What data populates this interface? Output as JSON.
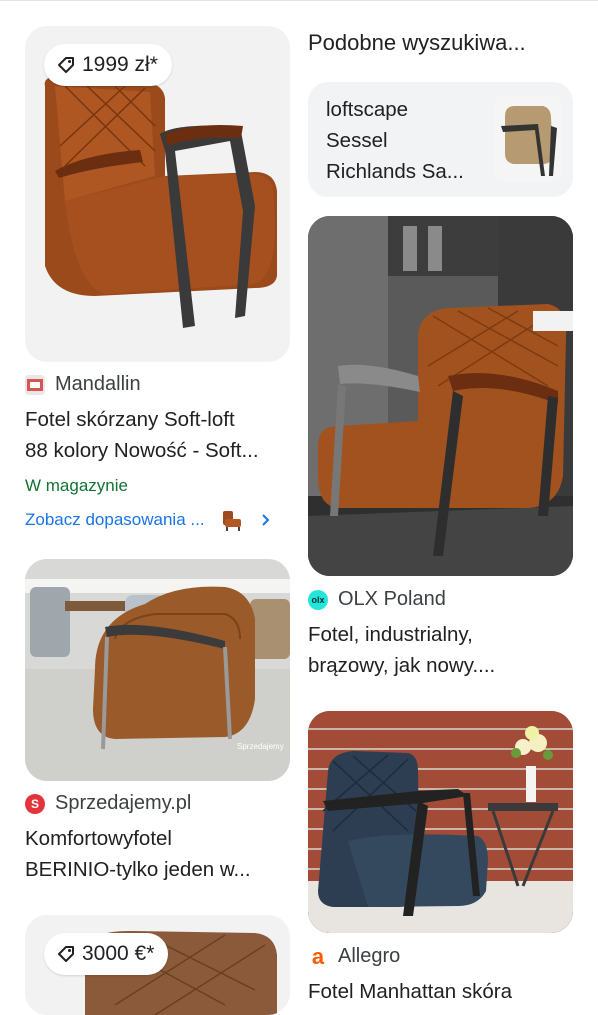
{
  "left": {
    "card1": {
      "price": "1999 zł*",
      "source": "Mandallin",
      "title_line1": "Fotel skórzany Soft-loft",
      "title_line2": "88 kolory Nowość - Soft...",
      "stock": "W magazynie",
      "match_link": "Zobacz dopasowania ..."
    },
    "card2": {
      "source": "Sprzedajemy.pl",
      "title_line1": "Komfortowyfotel",
      "title_line2": "BERINIO-tylko jeden w...",
      "watermark": "Sprzedajemy"
    },
    "card3": {
      "price": "3000 €*"
    }
  },
  "right": {
    "similar_heading": "Podobne wyszukiwa...",
    "similar_line1": "loftscape",
    "similar_line2": "Sessel",
    "similar_line3": "Richlands Sa...",
    "card1": {
      "source": "OLX Poland",
      "favicon_text": "olx",
      "title_line1": "Fotel, industrialny,",
      "title_line2": "brązowy, jak nowy...."
    },
    "card2": {
      "source": "Allegro",
      "favicon_text": "a",
      "title_line1": "Fotel Manhattan skóra"
    }
  },
  "colors": {
    "link": "#1a73e8",
    "stock": "#137333",
    "olx": "#23e5db",
    "allegro": "#ff5a00",
    "sprzedajemy": "#e4343b"
  }
}
